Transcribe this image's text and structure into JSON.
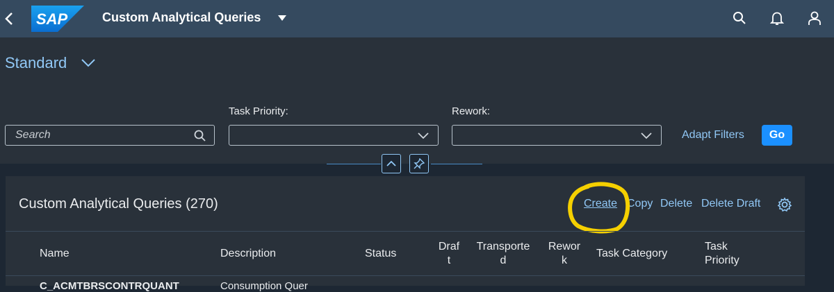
{
  "shell": {
    "logo_text": "SAP",
    "app_title": "Custom Analytical Queries",
    "icons": [
      "back-icon",
      "search-icon",
      "bell-icon",
      "user-icon"
    ]
  },
  "filter": {
    "variant": "Standard",
    "search_placeholder": "Search",
    "task_priority_label": "Task Priority:",
    "task_priority_value": "",
    "rework_label": "Rework:",
    "rework_value": "",
    "adapt_filters": "Adapt Filters",
    "go": "Go"
  },
  "table": {
    "title": "Custom Analytical Queries (270)",
    "actions": {
      "create": "Create",
      "copy": "Copy",
      "delete": "Delete",
      "delete_draft": "Delete Draft"
    },
    "columns": {
      "name": "Name",
      "description": "Description",
      "status": "Status",
      "draft_a": "Draf",
      "draft_b": "t",
      "transported_a": "Transporte",
      "transported_b": "d",
      "rework_a": "Rewor",
      "rework_b": "k",
      "task_category": "Task Category",
      "task_priority_a": "Task",
      "task_priority_b": "Priority"
    },
    "rows": [
      {
        "name": "C_ACMTBRSCONTRQUANT",
        "description": "Consumption Quer"
      }
    ]
  },
  "colors": {
    "shell": "#354a5f",
    "accent": "#91c8f6",
    "go_button": "#1b90ff",
    "highlight": "#f5d000"
  }
}
